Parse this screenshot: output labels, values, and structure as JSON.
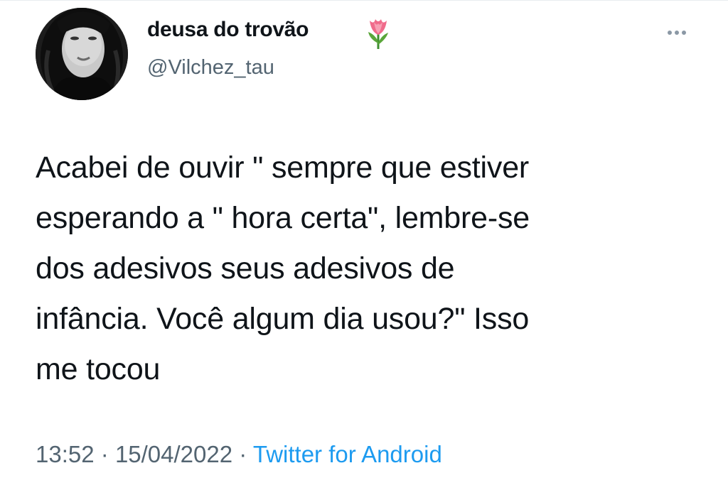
{
  "tweet": {
    "display_name": "deusa do trovão",
    "name_emoji": "tulip-emoji",
    "handle": "@Vilchez_tau",
    "text": "Acabei de ouvir \" sempre que estiver\nesperando a \" hora certa\", lembre-se\ndos adesivos seus adesivos de\ninfância. Você algum dia usou?\" Isso\nme tocou",
    "time": "13:52",
    "separator": "·",
    "date": "15/04/2022",
    "source": "Twitter for Android"
  },
  "icons": {
    "more": "more-horizontal-icon",
    "avatar": "profile-photo"
  },
  "colors": {
    "text": "#0f1419",
    "secondary": "#536471",
    "link": "#1d9bf0"
  }
}
